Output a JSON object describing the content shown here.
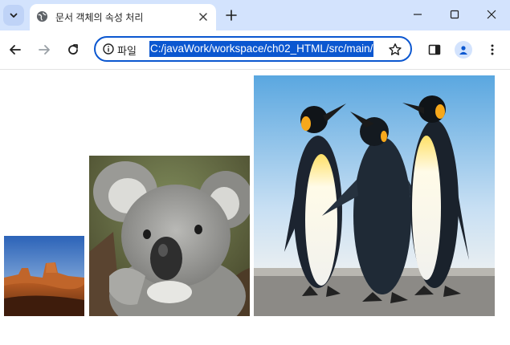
{
  "browser": {
    "tab_title": "문서 객체의 속성 처리",
    "address": {
      "scheme_label": "파일",
      "url": "C:/javaWork/workspace/ch02_HTML/src/main/"
    },
    "colors": {
      "tabstrip": "#d3e3fd",
      "accent": "#0b57d0"
    }
  },
  "page": {
    "images": [
      {
        "name": "desert",
        "description": "sandstone butte landscape"
      },
      {
        "name": "koala",
        "description": "koala photo"
      },
      {
        "name": "penguins",
        "description": "three penguins photo"
      }
    ]
  }
}
